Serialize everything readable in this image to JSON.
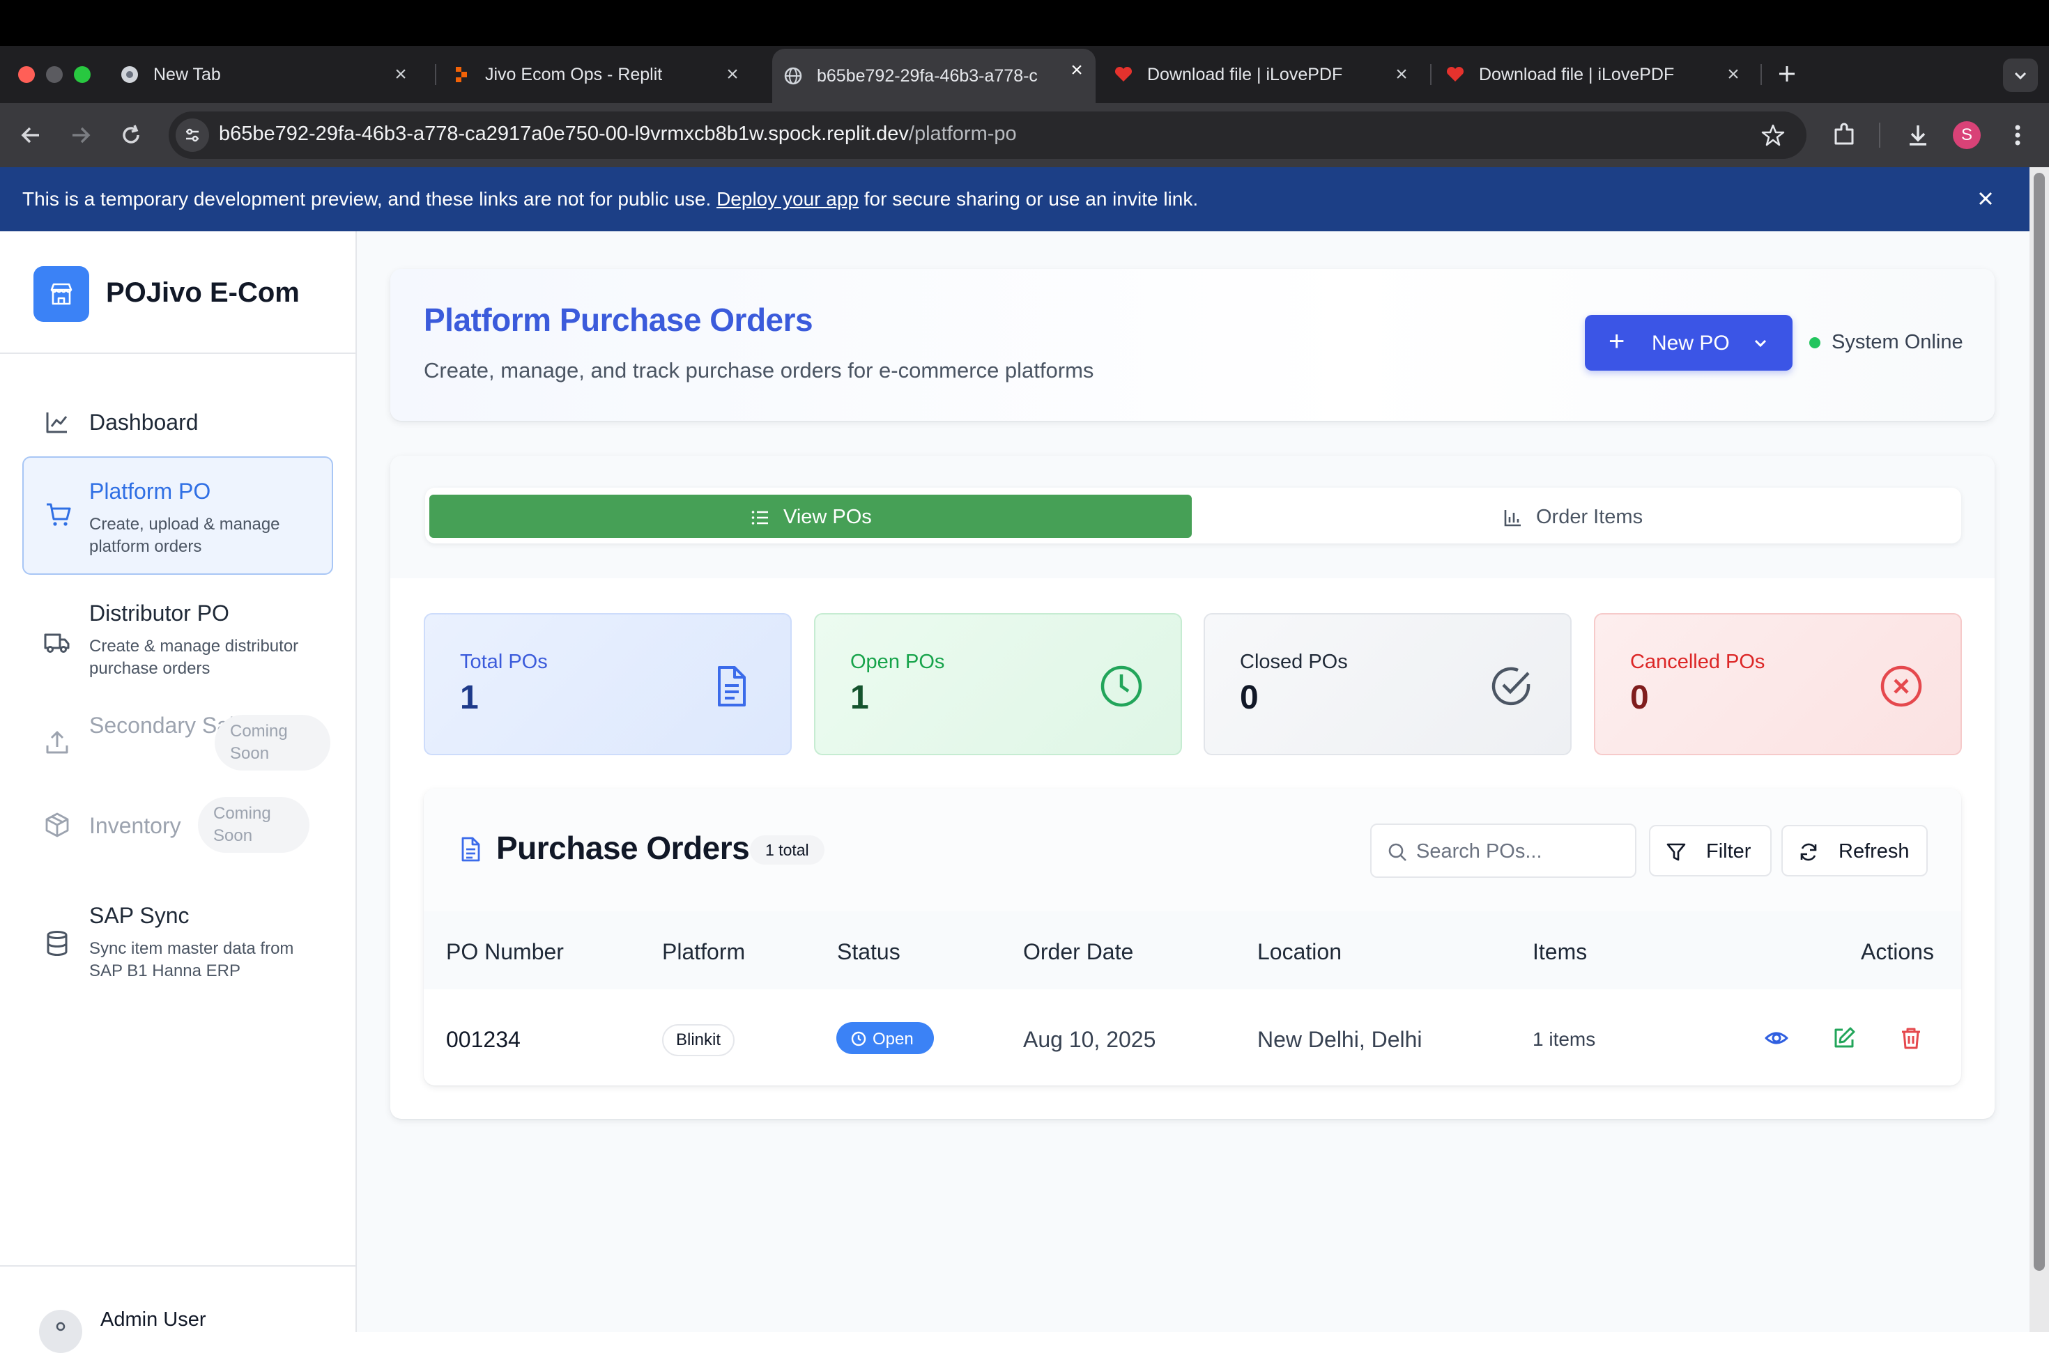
{
  "browser": {
    "tabs": [
      {
        "title": "New Tab",
        "active": false
      },
      {
        "title": "Jivo Ecom Ops - Replit",
        "active": false
      },
      {
        "title": "b65be792-29fa-46b3-a778-c",
        "active": true
      },
      {
        "title": "Download file | iLovePDF",
        "active": false
      },
      {
        "title": "Download file | iLovePDF",
        "active": false
      }
    ],
    "url_host": "b65be792-29fa-46b3-a778-ca2917a0e750-00-l9vrmxcb8b1w.spock.replit.dev",
    "url_path": "/platform-po",
    "profile_initial": "S"
  },
  "banner": {
    "text_before": "This is a temporary development preview, and these links are not for public use. ",
    "link": "Deploy your app",
    "text_after": " for secure sharing or use an invite link."
  },
  "sidebar": {
    "brand": "POJivo E-Com",
    "items": [
      {
        "label": "Dashboard",
        "icon": "chart-line-icon"
      },
      {
        "label": "Platform PO",
        "sub": "Create, upload & manage platform orders",
        "icon": "cart-icon",
        "active": true
      },
      {
        "label": "Distributor PO",
        "sub": "Create & manage distributor purchase orders",
        "icon": "truck-icon"
      },
      {
        "label": "Secondary Sales",
        "badge": "Coming Soon",
        "icon": "upload-icon",
        "disabled": true
      },
      {
        "label": "Inventory",
        "badge": "Coming Soon",
        "icon": "package-icon",
        "disabled": true
      },
      {
        "label": "SAP Sync",
        "sub": "Sync item master data from SAP B1 Hanna ERP",
        "icon": "database-icon"
      }
    ],
    "user": {
      "name": "Admin User"
    }
  },
  "header": {
    "title": "Platform Purchase Orders",
    "subtitle": "Create, manage, and track purchase orders for e-commerce platforms",
    "new_po": "New PO",
    "system_status": "System Online"
  },
  "tabs": {
    "view": "View POs",
    "items": "Order Items"
  },
  "stats": [
    {
      "label": "Total POs",
      "value": "1",
      "color": "#3b5bdb"
    },
    {
      "label": "Open POs",
      "value": "1",
      "color": "#16a34a"
    },
    {
      "label": "Closed POs",
      "value": "0",
      "color": "#4b5563"
    },
    {
      "label": "Cancelled POs",
      "value": "0",
      "color": "#dc2626"
    }
  ],
  "orders": {
    "title": "Purchase Orders",
    "count_badge": "1 total",
    "search_placeholder": "Search POs...",
    "filter": "Filter",
    "refresh": "Refresh",
    "columns": [
      "PO Number",
      "Platform",
      "Status",
      "Order Date",
      "Location",
      "Items",
      "Actions"
    ],
    "rows": [
      {
        "po_number": "001234",
        "platform": "Blinkit",
        "status": "Open",
        "order_date": "Aug 10, 2025",
        "location": "New Delhi, Delhi",
        "items": "1 items"
      }
    ]
  }
}
